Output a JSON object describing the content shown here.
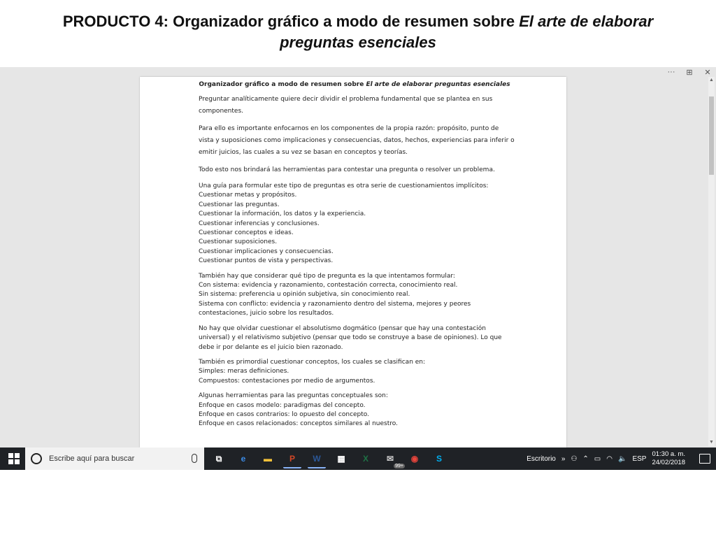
{
  "slide": {
    "title_prefix": "PRODUCTO 4: Organizador gráfico a modo de resumen sobre ",
    "title_italic": "El arte de elaborar preguntas esenciales"
  },
  "document": {
    "title_prefix": "Organizador gráfico a modo de resumen sobre ",
    "title_italic": "El arte de elaborar preguntas esenciales",
    "paragraphs": [
      {
        "style": "spaced",
        "lines": [
          "Preguntar analíticamente quiere decir dividir el problema fundamental que se plantea en sus",
          "componentes."
        ]
      },
      {
        "style": "spaced",
        "lines": [
          "Para ello es importante enfocarnos en los componentes de la propia razón: propósito, punto de",
          "vista y suposiciones como implicaciones y consecuencias, datos, hechos, experiencias para inferir o",
          "emitir juicios, las cuales a su vez se basan en conceptos y teorías."
        ]
      },
      {
        "style": "spaced",
        "lines": [
          "Todo esto nos brindará las herramientas para contestar una pregunta o resolver un problema."
        ]
      },
      {
        "style": "normal",
        "lines": [
          "Una guía para formular este tipo de preguntas es otra serie de cuestionamientos implícitos:",
          "Cuestionar metas y propósitos.",
          "Cuestionar las preguntas.",
          "Cuestionar la información, los datos y la experiencia.",
          "Cuestionar inferencias y conclusiones.",
          "Cuestionar conceptos e ideas.",
          "Cuestionar suposiciones.",
          "Cuestionar implicaciones y consecuencias.",
          "Cuestionar puntos de vista y perspectivas."
        ]
      },
      {
        "style": "normal",
        "lines": [
          "También hay que considerar qué tipo de pregunta es la que intentamos formular:",
          "Con sistema: evidencia y razonamiento, contestación correcta, conocimiento real.",
          "Sin sistema: preferencia  u opinión subjetiva, sin conocimiento real.",
          "Sistema con conflicto: evidencia y razonamiento dentro del sistema, mejores y peores",
          "contestaciones, juicio sobre los resultados."
        ]
      },
      {
        "style": "normal",
        "lines": [
          "No hay que olvidar cuestionar el absolutismo dogmático (pensar que hay una contestación",
          "universal) y el relativismo subjetivo (pensar que todo se construye a base de opiniones).  Lo que",
          "debe ir por delante es el juicio bien razonado."
        ]
      },
      {
        "style": "normal",
        "lines": [
          "También es primordial cuestionar conceptos, los cuales se clasifican en:",
          "Simples: meras definiciones.",
          "Compuestos: contestaciones por medio de argumentos."
        ]
      },
      {
        "style": "normal",
        "lines": [
          "Algunas herramientas para las preguntas conceptuales son:",
          "Enfoque en casos modelo: paradigmas del concepto.",
          "Enfoque en casos contrarios: lo opuesto del concepto.",
          "Enfoque en casos relacionados: conceptos similares al nuestro."
        ]
      }
    ]
  },
  "window_controls": {
    "more": "···",
    "layout": "⊞",
    "close": "✕"
  },
  "taskbar": {
    "search_placeholder": "Escribe aquí para buscar",
    "apps": [
      {
        "name": "task-view",
        "glyph": "⧉",
        "color": "#ffffff",
        "active": false
      },
      {
        "name": "edge",
        "glyph": "e",
        "color": "#3c8ce7",
        "active": false
      },
      {
        "name": "file-explorer",
        "glyph": "▬",
        "color": "#f3c13a",
        "active": false
      },
      {
        "name": "powerpoint",
        "glyph": "P",
        "color": "#d24726",
        "active": true
      },
      {
        "name": "word",
        "glyph": "W",
        "color": "#2b5797",
        "active": true
      },
      {
        "name": "store",
        "glyph": "▦",
        "color": "#ffffff",
        "active": false
      },
      {
        "name": "excel",
        "glyph": "X",
        "color": "#1e7145",
        "active": false
      },
      {
        "name": "mail",
        "glyph": "✉",
        "color": "#cccccc",
        "active": false
      },
      {
        "name": "chrome",
        "glyph": "◉",
        "color": "#e8453c",
        "active": false
      },
      {
        "name": "skype",
        "glyph": "S",
        "color": "#00aff0",
        "active": false
      }
    ],
    "mail_badge": "99+",
    "desktop_label": "Escritorio",
    "desktop_chevron": "»",
    "language": "ESP",
    "time": "01:30 a. m.",
    "date": "24/02/2018"
  }
}
